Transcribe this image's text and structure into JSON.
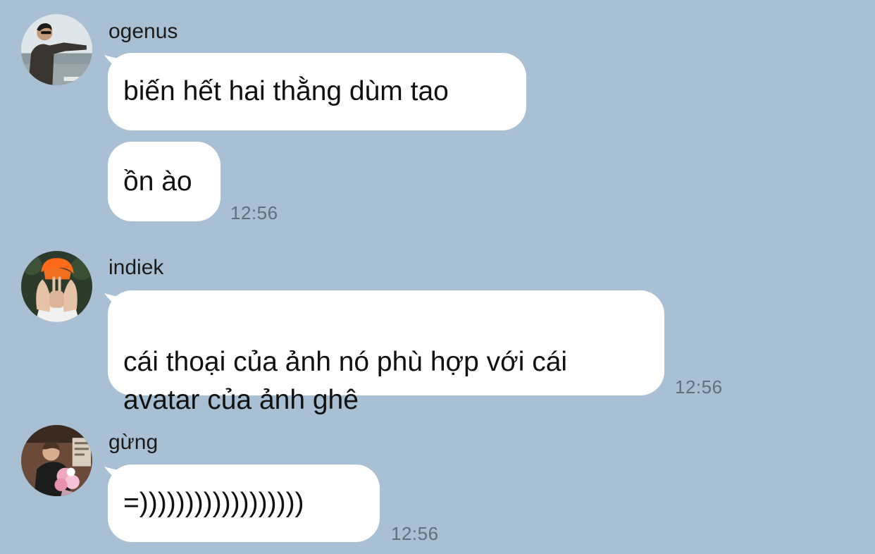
{
  "colors": {
    "background": "#a9bfd3",
    "bubble": "#ffffff",
    "timestamp": "#5f6f7e"
  },
  "groups": [
    {
      "sender": "ogenus",
      "avatar_icon": "person-pointing-seaside-avatar",
      "messages": [
        "biến hết hai thằng dùm tao",
        "ồn ào"
      ],
      "time": "12:56"
    },
    {
      "sender": "indiek",
      "avatar_icon": "orange-hair-hands-avatar",
      "messages": [
        "cái thoại của ảnh nó phù hợp với cái\navatar của ảnh ghê"
      ],
      "time": "12:56"
    },
    {
      "sender": "gừng",
      "avatar_icon": "person-with-flowers-avatar",
      "messages": [
        "=))))))))))))))))))"
      ],
      "time": "12:56"
    }
  ]
}
